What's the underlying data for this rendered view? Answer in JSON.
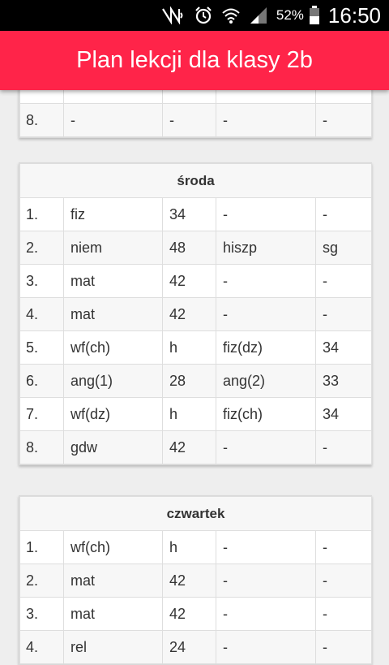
{
  "status_bar": {
    "battery_percent": "52%",
    "time": "16:50",
    "icons": [
      "nfc-icon",
      "alarm-icon",
      "wifi-icon",
      "signal-icon",
      "battery-icon"
    ]
  },
  "app_bar": {
    "title": "Plan lekcji dla klasy 2b"
  },
  "days": [
    {
      "name": "",
      "rows": [
        [
          "8.",
          "-",
          "-",
          "-",
          "-"
        ]
      ]
    },
    {
      "name": "środa",
      "rows": [
        [
          "1.",
          "fiz",
          "34",
          "-",
          "-"
        ],
        [
          "2.",
          "niem",
          "48",
          "hiszp",
          "sg"
        ],
        [
          "3.",
          "mat",
          "42",
          "-",
          "-"
        ],
        [
          "4.",
          "mat",
          "42",
          "-",
          "-"
        ],
        [
          "5.",
          "wf(ch)",
          "h",
          "fiz(dz)",
          "34"
        ],
        [
          "6.",
          "ang(1)",
          "28",
          "ang(2)",
          "33"
        ],
        [
          "7.",
          "wf(dz)",
          "h",
          "fiz(ch)",
          "34"
        ],
        [
          "8.",
          "gdw",
          "42",
          "-",
          "-"
        ]
      ]
    },
    {
      "name": "czwartek",
      "rows": [
        [
          "1.",
          "wf(ch)",
          "h",
          "-",
          "-"
        ],
        [
          "2.",
          "mat",
          "42",
          "-",
          "-"
        ],
        [
          "3.",
          "mat",
          "42",
          "-",
          "-"
        ],
        [
          "4.",
          "rel",
          "24",
          "-",
          "-"
        ]
      ]
    }
  ]
}
